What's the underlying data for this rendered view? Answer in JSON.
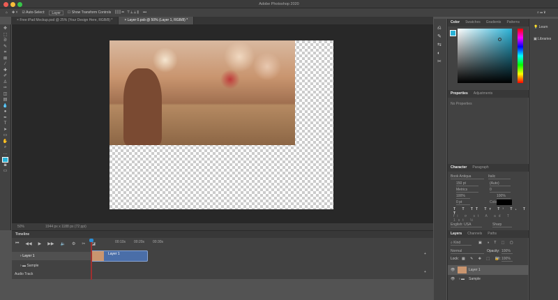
{
  "app": {
    "title": "Adobe Photoshop 2020"
  },
  "options": {
    "auto_select": "Auto-Select:",
    "layer_select": "Layer",
    "show_transform": "Show Transform Controls",
    "more": "•••"
  },
  "tabs": [
    {
      "label": "Free iPad Mockup.psd @ 25% (Your Design Here, RGB/8) *"
    },
    {
      "label": "Layer 0.psb @ 50% (Layer 1, RGB/8) *"
    }
  ],
  "status": {
    "zoom": "50%",
    "doc_info": "1944 px x 1188 px (72 ppi)"
  },
  "timeline": {
    "title": "Timeline",
    "times": [
      "00:10s",
      "00:20s",
      "00:30s"
    ],
    "tracks": [
      "Layer 1",
      "Sample",
      "Audio Track"
    ],
    "clip_label": "Layer 1"
  },
  "color_panel": {
    "tabs": [
      "Color",
      "Swatches",
      "Gradients",
      "Patterns"
    ],
    "fg_color": "#2ab3d8"
  },
  "properties_panel": {
    "tabs": [
      "Properties",
      "Adjustments"
    ],
    "empty": "No Properties"
  },
  "character_panel": {
    "tabs": [
      "Character",
      "Paragraph"
    ],
    "font": "Book Antiqua",
    "style": "Italic",
    "size": "150 pt",
    "leading": "(Auto)",
    "kerning": "Metrics",
    "tracking": "0",
    "vscale": "100%",
    "hscale": "100%",
    "baseline": "0 pt",
    "color_label": "Color:",
    "language": "English: USA",
    "antialias": "Sharp"
  },
  "layers_panel": {
    "tabs": [
      "Layers",
      "Channels",
      "Paths"
    ],
    "filter": "Kind",
    "blend": "Normal",
    "opacity_label": "Opacity:",
    "opacity": "100%",
    "lock_label": "Lock:",
    "fill_label": "Fill:",
    "fill": "100%",
    "layers": [
      "Layer 1",
      "Sample"
    ]
  },
  "right_col": {
    "items": [
      "Learn",
      "Libraries"
    ]
  }
}
